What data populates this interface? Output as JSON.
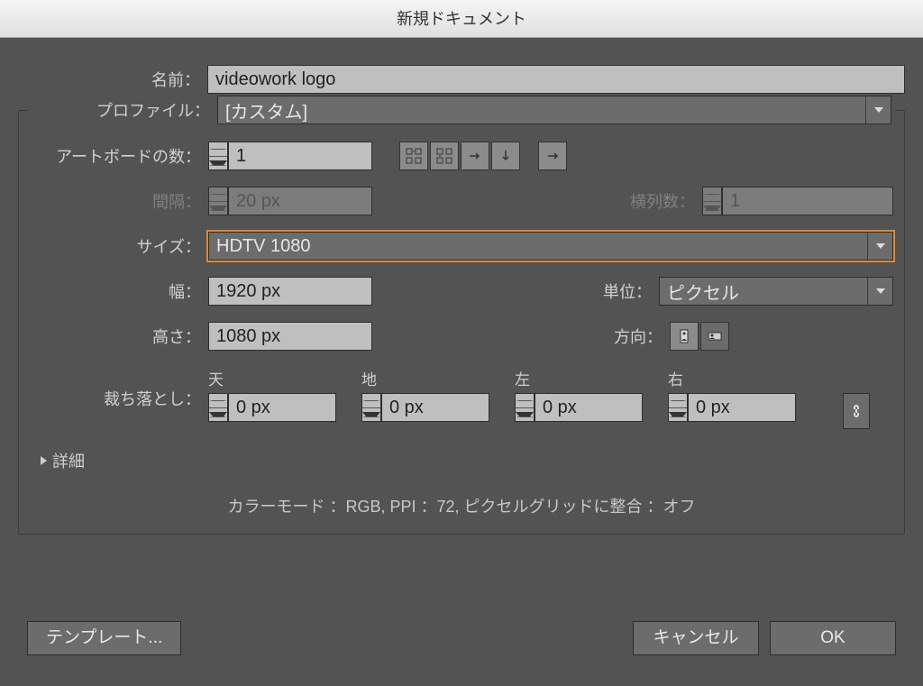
{
  "title": "新規ドキュメント",
  "labels": {
    "name": "名前：",
    "profile": "プロファイル：",
    "artboards": "アートボードの数：",
    "spacing": "間隔：",
    "columns": "横列数：",
    "size": "サイズ：",
    "width": "幅：",
    "height": "高さ：",
    "units": "単位：",
    "orientation": "方向：",
    "bleed": "裁ち落とし：",
    "top": "天",
    "bottom": "地",
    "left": "左",
    "right": "右",
    "advanced": "詳細"
  },
  "values": {
    "name": "videowork logo",
    "profile": "[カスタム]",
    "artboards": "1",
    "spacing": "20 px",
    "columns": "1",
    "size": "HDTV 1080",
    "width": "1920 px",
    "height": "1080 px",
    "units": "ピクセル",
    "bleed_top": "0 px",
    "bleed_bottom": "0 px",
    "bleed_left": "0 px",
    "bleed_right": "0 px"
  },
  "summary": "カラーモード ：RGB, PPI ：72, ピクセルグリッドに整合 ：オフ",
  "buttons": {
    "template": "テンプレート...",
    "cancel": "キャンセル",
    "ok": "OK"
  }
}
